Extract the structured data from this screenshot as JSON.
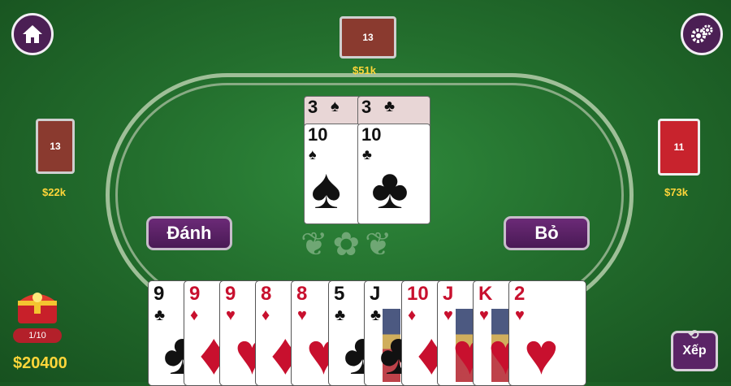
{
  "top_player": {
    "card_count": "13",
    "money": "$51k"
  },
  "left_player": {
    "card_count": "13",
    "money": "$22k"
  },
  "right_player": {
    "card_count": "11",
    "money": "$73k"
  },
  "center_cards": [
    {
      "rank": "3",
      "suit": "♠",
      "color": "#111111"
    },
    {
      "rank": "3",
      "suit": "♣",
      "color": "#111111"
    },
    {
      "rank": "10",
      "suit": "♠",
      "color": "#111111"
    },
    {
      "rank": "10",
      "suit": "♣",
      "color": "#111111"
    }
  ],
  "buttons": {
    "play": "Đánh",
    "pass": "Bỏ",
    "sort": "Xếp"
  },
  "hand": [
    {
      "rank": "9",
      "suit": "♣",
      "color": "black"
    },
    {
      "rank": "9",
      "suit": "♦",
      "color": "red"
    },
    {
      "rank": "9",
      "suit": "♥",
      "color": "red"
    },
    {
      "rank": "8",
      "suit": "♦",
      "color": "red"
    },
    {
      "rank": "8",
      "suit": "♥",
      "color": "red"
    },
    {
      "rank": "5",
      "suit": "♣",
      "color": "black"
    },
    {
      "rank": "J",
      "suit": "♣",
      "color": "black"
    },
    {
      "rank": "10",
      "suit": "♦",
      "color": "red"
    },
    {
      "rank": "J",
      "suit": "♥",
      "color": "red"
    },
    {
      "rank": "K",
      "suit": "♥",
      "color": "red"
    },
    {
      "rank": "2",
      "suit": "♥",
      "color": "red"
    }
  ],
  "player": {
    "chest_counter": "1/10",
    "balance": "$20400"
  },
  "icons": {
    "home": "home-icon",
    "settings": "gear-icon",
    "sort": "refresh-arrows-icon",
    "chest": "treasure-chest-icon"
  }
}
